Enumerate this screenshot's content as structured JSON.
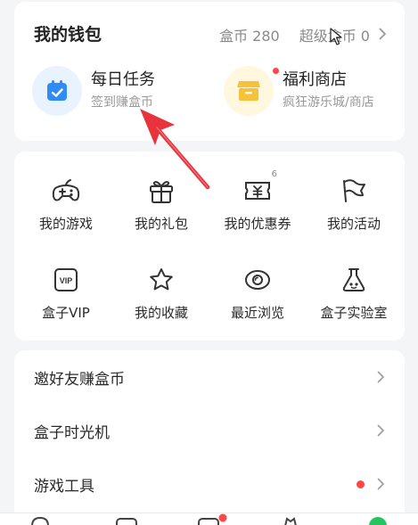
{
  "wallet": {
    "title": "我的钱包",
    "coins_label": "盒币 280",
    "super_coins_label": "超级盒币 0",
    "features": [
      {
        "title": "每日任务",
        "subtitle": "签到赚盒币",
        "icon": "calendar-icon",
        "color": "#2f8cf6"
      },
      {
        "title": "福利商店",
        "subtitle": "疯狂游乐城/商店",
        "icon": "shop-icon",
        "color": "#f6c23b"
      }
    ]
  },
  "grid": {
    "items": [
      {
        "label": "我的游戏",
        "icon": "gamepad-icon"
      },
      {
        "label": "我的礼包",
        "icon": "gift-icon"
      },
      {
        "label": "我的优惠券",
        "icon": "coupon-icon",
        "badge": "6"
      },
      {
        "label": "我的活动",
        "icon": "flag-icon"
      },
      {
        "label": "盒子VIP",
        "icon": "vip-icon"
      },
      {
        "label": "我的收藏",
        "icon": "star-icon"
      },
      {
        "label": "最近浏览",
        "icon": "eye-icon"
      },
      {
        "label": "盒子实验室",
        "icon": "flask-icon"
      }
    ]
  },
  "list": {
    "items": [
      {
        "label": "邀好友赚盒币"
      },
      {
        "label": "盒子时光机"
      },
      {
        "label": "游戏工具",
        "dot": true
      }
    ]
  },
  "colors": {
    "accent_red": "#ff4646",
    "arrow_red": "#e8323c"
  }
}
